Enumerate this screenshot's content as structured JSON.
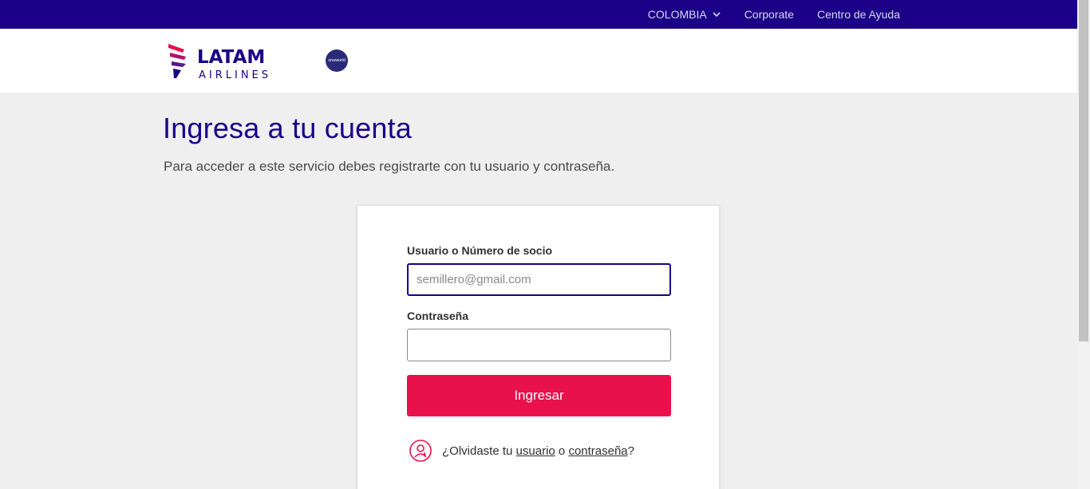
{
  "topbar": {
    "country": "COLOMBIA",
    "corporate": "Corporate",
    "help": "Centro de Ayuda"
  },
  "header": {
    "logo_text": "LATAM",
    "logo_subtext": "AIRLINES",
    "oneworld": "oneworld"
  },
  "page": {
    "title": "Ingresa a tu cuenta",
    "subtitle": "Para acceder a este servicio debes registrarte con tu usuario y contraseña."
  },
  "form": {
    "user_label": "Usuario o Número de socio",
    "user_placeholder": "semillero@gmail.com",
    "password_label": "Contraseña",
    "password_value": "",
    "submit_label": "Ingresar",
    "forgot_prefix": "¿Olvidaste tu",
    "forgot_user": "usuario",
    "forgot_or": "o",
    "forgot_password": "contraseña",
    "forgot_suffix": "?"
  },
  "colors": {
    "brand_purple": "#1b0088",
    "brand_red": "#e8114b"
  },
  "icons": {
    "country_dropdown": "chevron-down-icon",
    "forgot": "user-help-icon"
  }
}
